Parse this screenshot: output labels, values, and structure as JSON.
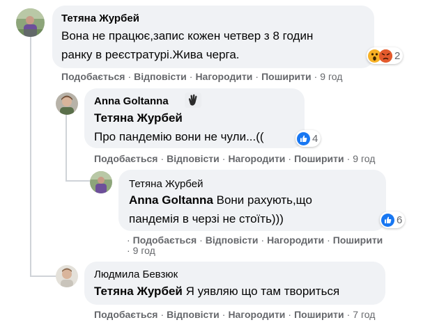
{
  "comments": [
    {
      "author": "Тетяна Журбей",
      "text_line1": "Вона не працює,запис кожен четвер з 8 годин",
      "text_line2": "ранку в реєстратурі.Жива черга.",
      "reaction_icons": [
        "wow-reaction-icon",
        "angry-reaction-icon"
      ],
      "reaction_count": "2",
      "actions": [
        "Подобається",
        "Відповісти",
        "Нагородити",
        "Поширити"
      ],
      "time": "9 год"
    },
    {
      "author": "Anna Goltanna",
      "badge_icon": "waving-hand-icon",
      "mention": "Тетяна Журбей",
      "text": "Про пандемію вони не чули...((",
      "reaction_icons": [
        "like-reaction-icon"
      ],
      "reaction_count": "4",
      "actions": [
        "Подобається",
        "Відповісти",
        "Нагородити",
        "Поширити"
      ],
      "time": "9 год"
    },
    {
      "author": "Тетяна Журбей",
      "mention": "Anna Goltanna",
      "text_line1_rest": " Вони рахують,що",
      "text_line2": "пандемія в черзі не стоїть)))",
      "reaction_icons": [
        "like-reaction-icon"
      ],
      "reaction_count": "6",
      "actions": [
        "Подобається",
        "Відповісти",
        "Нагородити",
        "Поширити"
      ],
      "time": "9 год"
    },
    {
      "author": "Людмила Бевзюк",
      "mention": "Тетяна Журбей",
      "text_rest": " Я уявляю що там твориться",
      "actions": [
        "Подобається",
        "Відповісти",
        "Нагородити",
        "Поширити"
      ],
      "time": "7 год"
    }
  ],
  "separator": "·",
  "colors": {
    "bubble": "#f0f2f5",
    "meta_text": "#65676b",
    "like_blue": "#1877f2",
    "thread_line": "#cfd3d8"
  }
}
